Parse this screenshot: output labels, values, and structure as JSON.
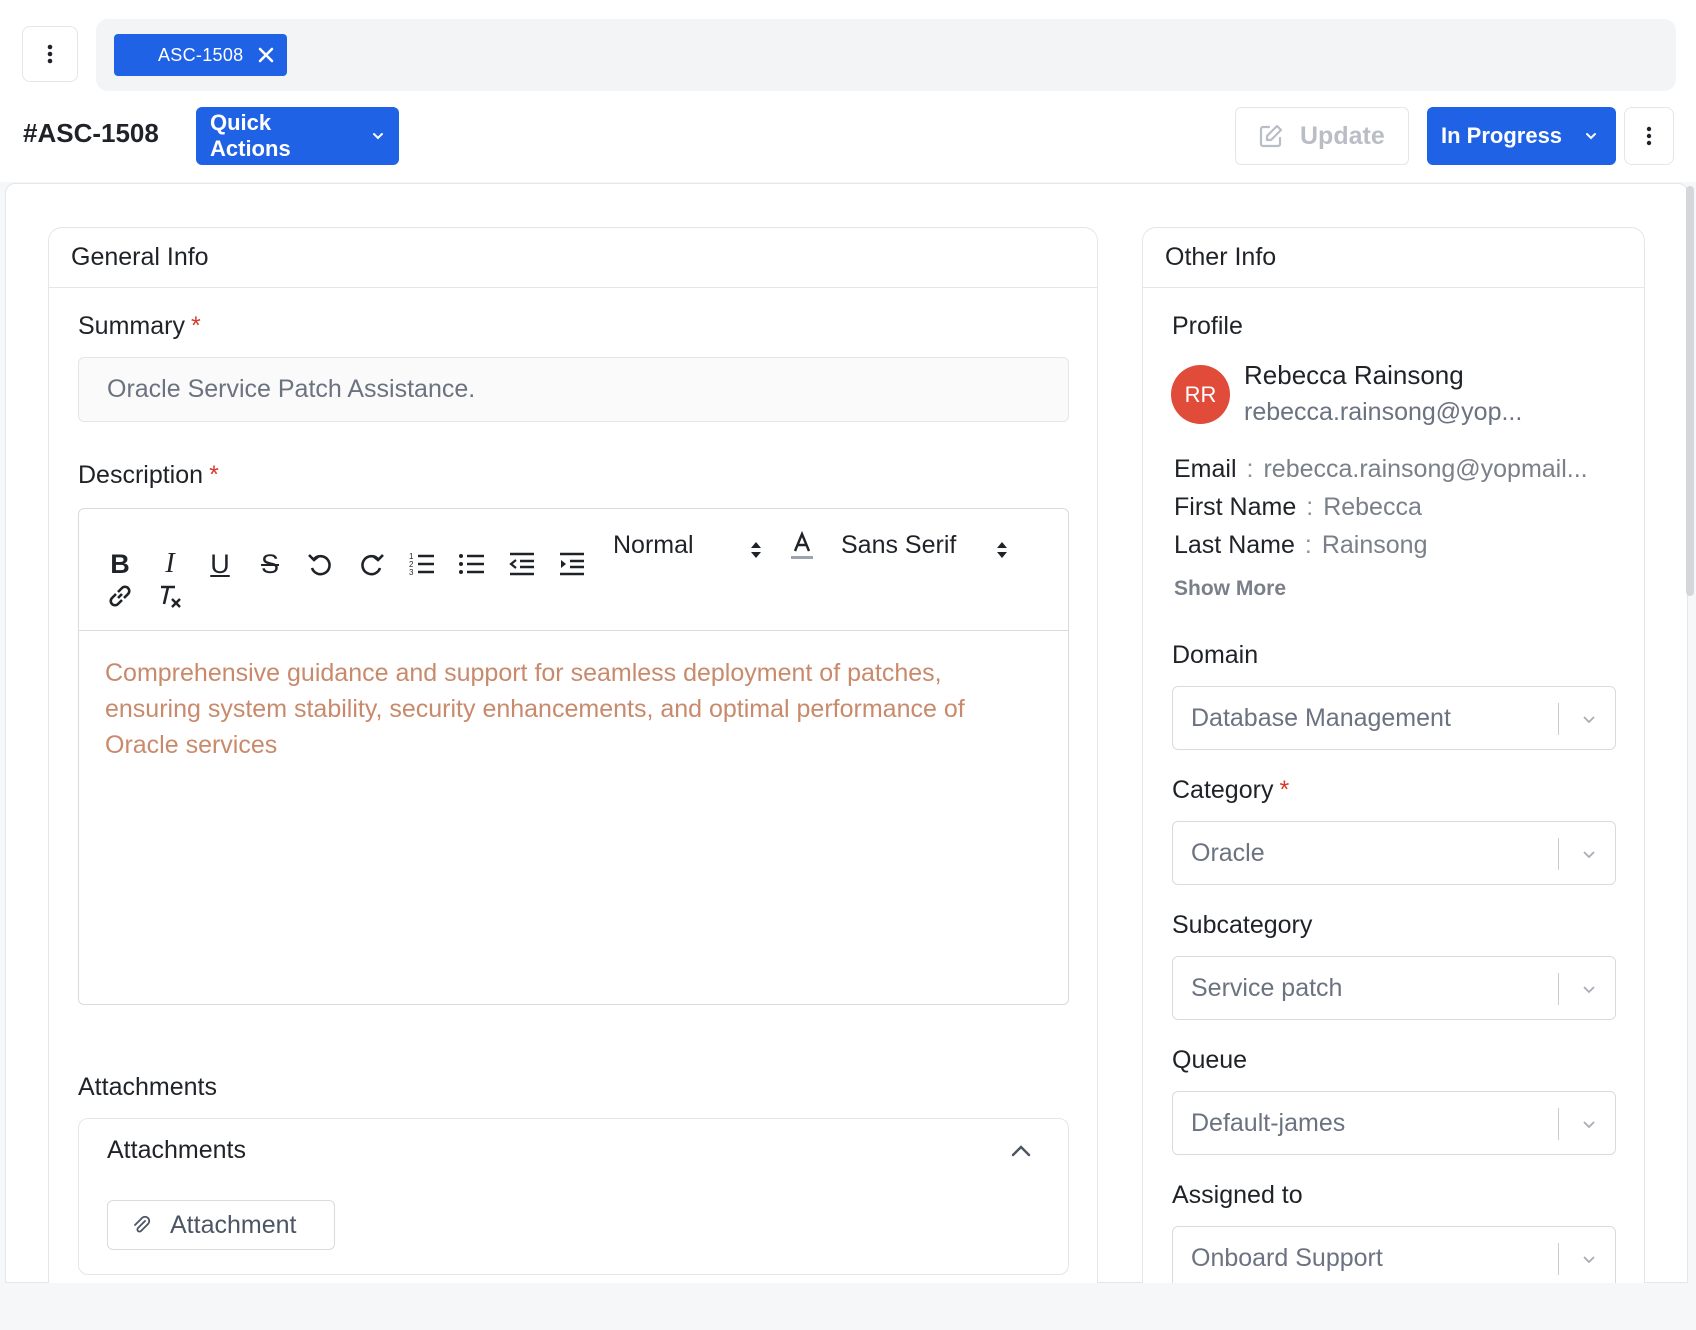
{
  "tabs": [
    {
      "label": "ASC-1508"
    }
  ],
  "header": {
    "ticket_id": "#ASC-1508",
    "quick_actions_label": "Quick Actions",
    "update_label": "Update",
    "status_label": "In Progress"
  },
  "general_info": {
    "title": "General Info",
    "summary_label": "Summary",
    "summary_value": "Oracle Service Patch Assistance.",
    "description_label": "Description",
    "toolbar": {
      "format_value": "Normal",
      "font_value": "Sans Serif"
    },
    "description_value": "Comprehensive guidance and support for seamless deployment of patches, ensuring system stability, security enhancements, and optimal performance of Oracle services",
    "attachments_label": "Attachments",
    "attachments_section_title": "Attachments",
    "attachment_button_label": "Attachment"
  },
  "other_info": {
    "title": "Other Info",
    "profile_label": "Profile",
    "profile": {
      "initials": "RR",
      "name": "Rebecca Rainsong",
      "email_short": "rebecca.rainsong@yop...",
      "email_label": "Email",
      "email_value": "rebecca.rainsong@yopmail...",
      "first_name_label": "First Name",
      "first_name_value": "Rebecca",
      "last_name_label": "Last Name",
      "last_name_value": "Rainsong",
      "separator": ":",
      "show_more_label": "Show More"
    },
    "domain_label": "Domain",
    "domain_value": "Database Management",
    "category_label": "Category",
    "category_value": "Oracle",
    "subcategory_label": "Subcategory",
    "subcategory_value": "Service patch",
    "queue_label": "Queue",
    "queue_value": "Default-james",
    "assigned_to_label": "Assigned to",
    "assigned_to_value": "Onboard Support"
  },
  "required_marker": "*",
  "colors": {
    "primary": "#1f62e6",
    "required": "#d33a2c",
    "avatar": "#e04b3a",
    "description_text": "#c98a6c"
  }
}
